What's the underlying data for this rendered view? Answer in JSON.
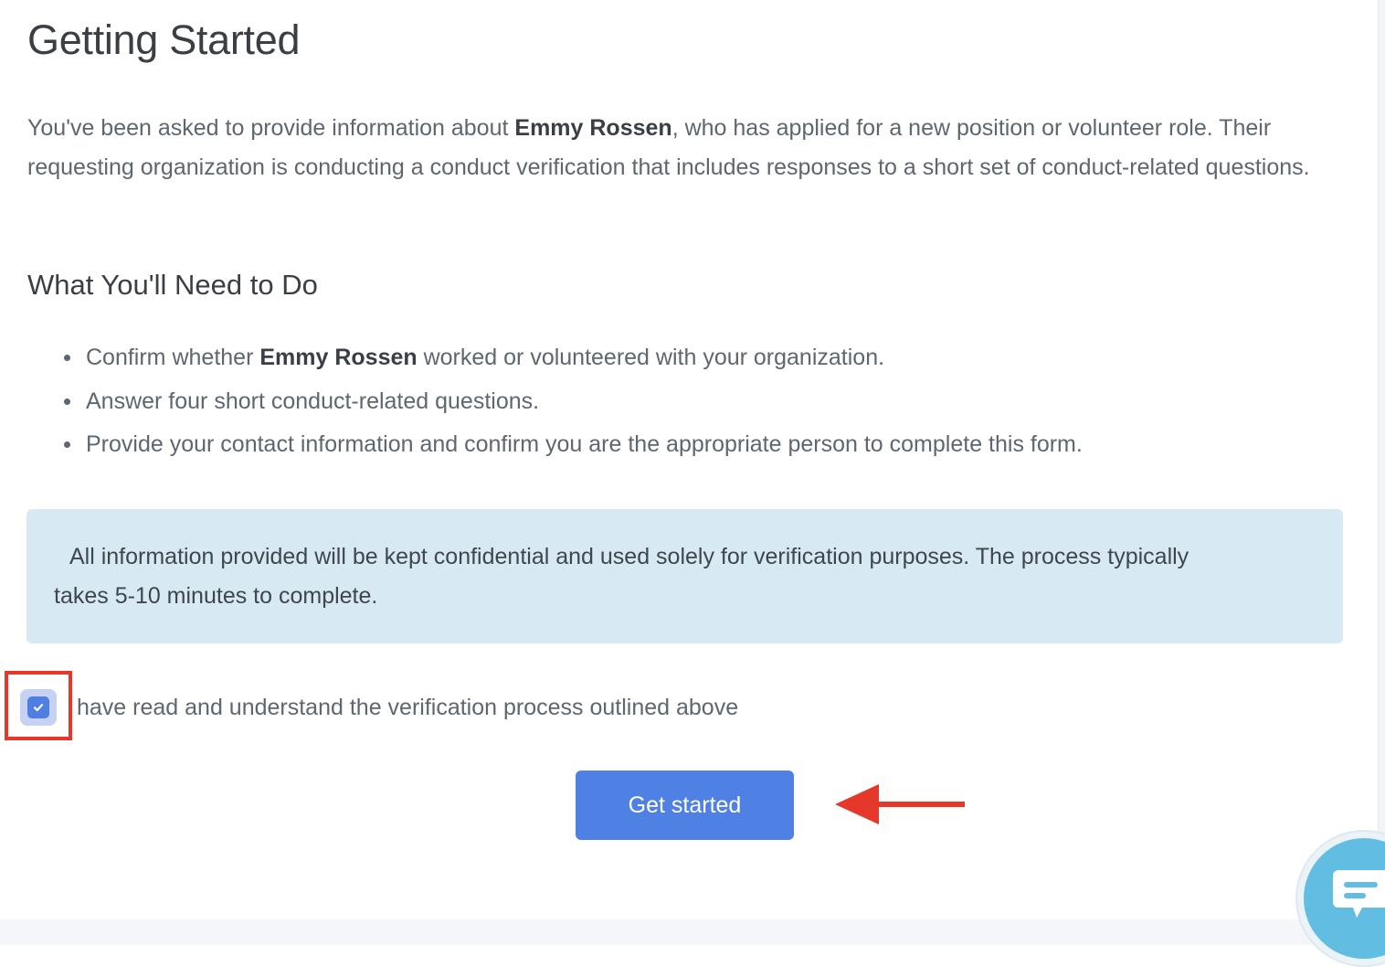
{
  "page": {
    "title": "Getting Started",
    "intro": {
      "prefix": "You've been asked to provide information about ",
      "applicant_name": "Emmy Rossen",
      "suffix": ", who has applied for a new position or volunteer role. Their requesting organization is conducting a conduct verification that includes responses to a short set of conduct-related questions."
    }
  },
  "section": {
    "title": "What You'll Need to Do",
    "items": [
      {
        "prefix": "Confirm whether ",
        "name": "Emmy Rossen",
        "suffix": " worked or volunteered with your organization."
      },
      {
        "text": "Answer four short conduct-related questions."
      },
      {
        "text": "Provide your contact information and confirm you are the appropriate person to complete this form."
      }
    ]
  },
  "notice": {
    "text": "All information provided will be kept confidential and used solely for verification purposes. The process typically takes 5-10 minutes to complete."
  },
  "acknowledgement": {
    "checked": true,
    "label": "have read and understand the verification process outlined above"
  },
  "actions": {
    "primary_label": "Get started"
  },
  "colors": {
    "primary": "#4f80e3",
    "notice_background": "#d7e9f2",
    "annotation": "#e5372a",
    "chat_widget": "#62bde3"
  },
  "icons": {
    "checkbox": "checkmark-icon",
    "chat": "chat-bubble-icon",
    "annotation": "red-arrow-left-icon"
  }
}
